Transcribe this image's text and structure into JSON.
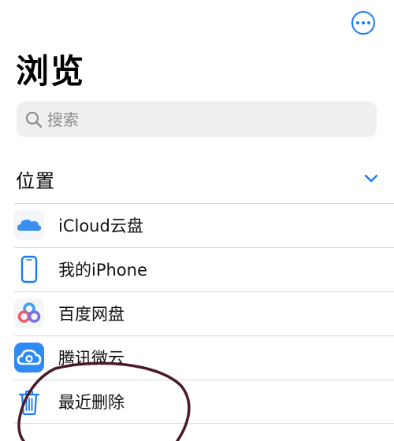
{
  "header": {
    "title": "浏览",
    "more_icon": "ellipsis-circle-icon"
  },
  "search": {
    "placeholder": "搜索",
    "value": ""
  },
  "locations_section": {
    "title": "位置",
    "toggle_icon": "chevron-down-icon",
    "items": [
      {
        "label": "iCloud云盘",
        "icon": "icloud-icon"
      },
      {
        "label": "我的iPhone",
        "icon": "iphone-icon"
      },
      {
        "label": "百度网盘",
        "icon": "baidu-netdisk-icon"
      },
      {
        "label": "腾讯微云",
        "icon": "tencent-weiyun-icon"
      },
      {
        "label": "最近删除",
        "icon": "trash-icon"
      }
    ]
  },
  "colors": {
    "accent": "#1a7af8",
    "search_bg": "#efeff1",
    "separator": "#d8d8dc",
    "annotation": "#4a1a2a"
  }
}
